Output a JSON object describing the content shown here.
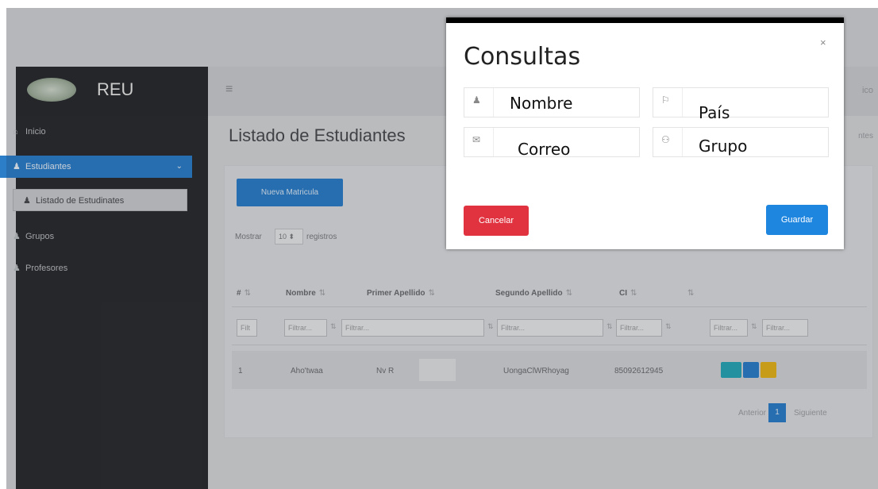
{
  "sidebar": {
    "brand": "REU",
    "items": [
      {
        "label": "Inicio",
        "icon": "home-icon"
      },
      {
        "label": "Estudiantes",
        "icon": "user-icon"
      },
      {
        "label": "Grupos",
        "icon": "user-icon"
      },
      {
        "label": "Profesores",
        "icon": "user-icon"
      }
    ],
    "sub_item": "Listado de Estudinates"
  },
  "topbar": {
    "menu_icon": "hamburger-icon",
    "user_text": "ico"
  },
  "main": {
    "title": "Listado de Estudiantes",
    "breadcrumb": "ntes",
    "new_button": "Nueva Matricula",
    "show_prefix": "Mostrar",
    "show_value": "10",
    "show_suffix": "registros",
    "columns": [
      "#",
      "Nombre",
      "Primer Apellido",
      "Segundo Apellido",
      "CI"
    ],
    "filter_first": "Filt",
    "filter_placeholder": "Filtrar...",
    "rows": [
      {
        "num": "1",
        "nombre": "Aho'twaa",
        "primer": "Nv R",
        "segundo": "UongaClWRhoyag",
        "ci": "85092612945"
      }
    ],
    "pager": {
      "prev": "Anterior",
      "page": "1",
      "next": "Siguiente"
    }
  },
  "modal": {
    "title": "Consultas",
    "close": "×",
    "fields": {
      "nombre": "Nombre",
      "pais": "País",
      "correo": "Correo",
      "grupo": "Grupo"
    },
    "cancel": "Cancelar",
    "save": "Guardar"
  },
  "colors": {
    "primary": "#2d7ec9",
    "danger": "#e0333f",
    "save": "#1f86e0",
    "sidebar": "#2b2d31"
  }
}
